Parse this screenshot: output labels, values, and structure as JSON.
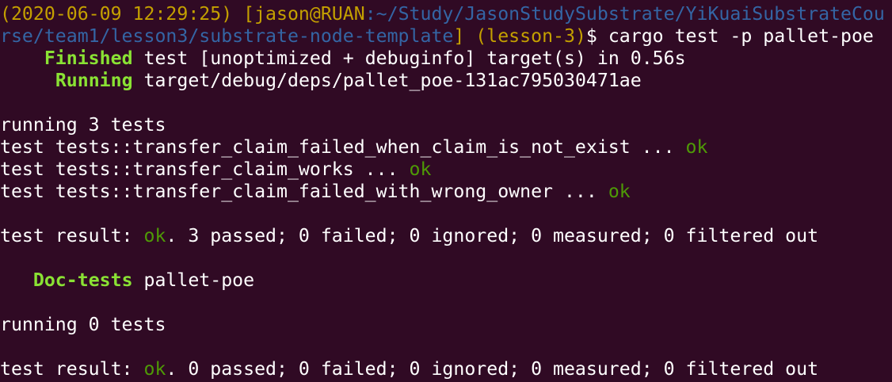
{
  "prompt": {
    "timestamp": "(2020-06-09 12:29:25)",
    "open_bracket": " [",
    "user_host": "jason@RUAN",
    "path_part1": ":~/Study/JasonStudySubstrate/YiKuaiSubstrateCou",
    "path_part2": "rse/team1/lesson3/substrate-node-template",
    "close_bracket": "]",
    "branch": " (lesson-3)",
    "dollar": "$",
    "command": " cargo test -p pallet-poe"
  },
  "build": {
    "finished_label": "Finished",
    "finished_text": " test [unoptimized + debuginfo] target(s) in 0.56s",
    "running_label": "Running",
    "running_text": " target/debug/deps/pallet_poe-131ac795030471ae"
  },
  "unit_tests": {
    "header": "running 3 tests",
    "tests": [
      {
        "text": "test tests::transfer_claim_failed_when_claim_is_not_exist ... ",
        "status": "ok"
      },
      {
        "text": "test tests::transfer_claim_works ... ",
        "status": "ok"
      },
      {
        "text": "test tests::transfer_claim_failed_with_wrong_owner ... ",
        "status": "ok"
      }
    ],
    "result_prefix": "test result: ",
    "result_status": "ok",
    "result_text": ". 3 passed; 0 failed; 0 ignored; 0 measured; 0 filtered out"
  },
  "doc_tests": {
    "label": "Doc-tests",
    "crate": " pallet-poe",
    "header": "running 0 tests",
    "result_prefix": "test result: ",
    "result_status": "ok",
    "result_text": ". 0 passed; 0 failed; 0 ignored; 0 measured; 0 filtered out"
  },
  "colors": {
    "background": "#300a24",
    "foreground": "#ffffff",
    "prompt_yellow": "#c4a000",
    "prompt_blue": "#3465a4",
    "ok_green": "#4e9a06",
    "cargo_bold_green": "#8ae234"
  }
}
